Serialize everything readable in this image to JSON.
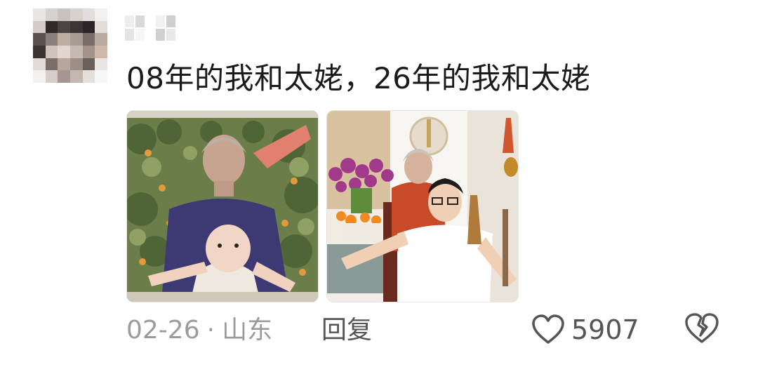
{
  "comment": {
    "text": "08年的我和太姥，26年的我和太姥",
    "date": "02-26",
    "separator": "·",
    "location": "山东",
    "reply_label": "回复",
    "like_count": "5907"
  },
  "icons": {
    "like": "heart-outline-icon",
    "dislike": "broken-heart-icon"
  },
  "colors": {
    "text_primary": "#1a1a1a",
    "text_meta": "#9b9b9b",
    "text_action": "#555555"
  }
}
